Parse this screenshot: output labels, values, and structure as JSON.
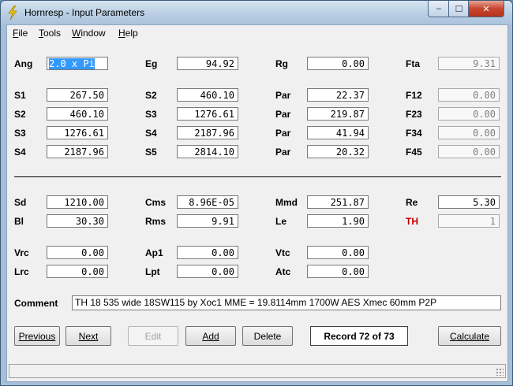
{
  "window": {
    "title": "Hornresp - Input Parameters",
    "controls": {
      "minimize": "‒",
      "maximize": "☐",
      "close": "✕"
    }
  },
  "menu": [
    {
      "key": "F",
      "rest": "ile"
    },
    {
      "key": "T",
      "rest": "ools"
    },
    {
      "key": "W",
      "rest": "indow"
    },
    {
      "key": "H",
      "rest": "elp"
    }
  ],
  "params": {
    "ang": {
      "label": "Ang",
      "value": "2.0 x Pi"
    },
    "eg": {
      "label": "Eg",
      "value": "94.92"
    },
    "rg": {
      "label": "Rg",
      "value": "0.00"
    },
    "fta": {
      "label": "Fta",
      "value": "9.31"
    },
    "s1": {
      "label": "S1",
      "value": "267.50"
    },
    "s2a": {
      "label": "S2",
      "value": "460.10"
    },
    "par1": {
      "label": "Par",
      "value": "22.37"
    },
    "f12": {
      "label": "F12",
      "value": "0.00"
    },
    "s2b": {
      "label": "S2",
      "value": "460.10"
    },
    "s3a": {
      "label": "S3",
      "value": "1276.61"
    },
    "par2": {
      "label": "Par",
      "value": "219.87"
    },
    "f23": {
      "label": "F23",
      "value": "0.00"
    },
    "s3b": {
      "label": "S3",
      "value": "1276.61"
    },
    "s4a": {
      "label": "S4",
      "value": "2187.96"
    },
    "par3": {
      "label": "Par",
      "value": "41.94"
    },
    "f34": {
      "label": "F34",
      "value": "0.00"
    },
    "s4b": {
      "label": "S4",
      "value": "2187.96"
    },
    "s5": {
      "label": "S5",
      "value": "2814.10"
    },
    "par4": {
      "label": "Par",
      "value": "20.32"
    },
    "f45": {
      "label": "F45",
      "value": "0.00"
    },
    "sd": {
      "label": "Sd",
      "value": "1210.00"
    },
    "cms": {
      "label": "Cms",
      "value": "8.96E-05"
    },
    "mmd": {
      "label": "Mmd",
      "value": "251.87"
    },
    "re": {
      "label": "Re",
      "value": "5.30"
    },
    "bl": {
      "label": "Bl",
      "value": "30.30"
    },
    "rms": {
      "label": "Rms",
      "value": "9.91"
    },
    "le": {
      "label": "Le",
      "value": "1.90"
    },
    "th": {
      "label": "TH",
      "value": "1"
    },
    "vrc": {
      "label": "Vrc",
      "value": "0.00"
    },
    "ap1": {
      "label": "Ap1",
      "value": "0.00"
    },
    "vtc": {
      "label": "Vtc",
      "value": "0.00"
    },
    "lrc": {
      "label": "Lrc",
      "value": "0.00"
    },
    "lpt": {
      "label": "Lpt",
      "value": "0.00"
    },
    "atc": {
      "label": "Atc",
      "value": "0.00"
    }
  },
  "comment": {
    "label": "Comment",
    "value": "TH 18 535 wide 18SW115 by Xoc1 MME = 19.8114mm 1700W AES Xmec 60mm P2P"
  },
  "buttons": {
    "previous": "Previous",
    "next": "Next",
    "edit": "Edit",
    "add": "Add",
    "delete": "Delete",
    "calculate": "Calculate"
  },
  "record": "Record 72 of 73",
  "colors": {
    "th_label": "#c00000",
    "selection": "#3399ff"
  }
}
